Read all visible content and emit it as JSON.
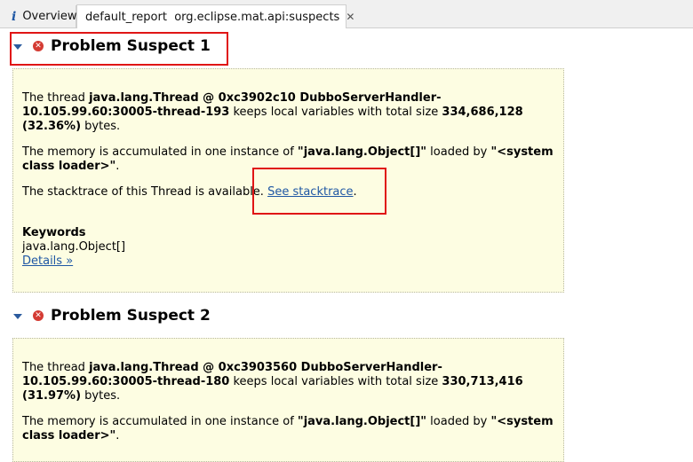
{
  "tabs": [
    {
      "label": "Overview",
      "icon": "info-icon"
    },
    {
      "label": "default_report  org.eclipse.mat.api:suspects",
      "icon": "gear-icon",
      "closable": true
    }
  ],
  "suspect1": {
    "title": "Problem Suspect 1",
    "p1": {
      "pre": "The thread ",
      "thread": "java.lang.Thread @ 0xc3902c10 DubboServerHandler-10.105.99.60:30005-thread-193",
      "mid": " keeps local variables with total size ",
      "size": "334,686,128",
      "sp": " ",
      "pct": "(32.36%)",
      "post": " bytes."
    },
    "p2": {
      "pre": "The memory is accumulated in one instance of ",
      "cls": "\"java.lang.Object[]\"",
      "mid": " loaded by ",
      "loader": "\"<system class loader>\"",
      "post": "."
    },
    "p3": {
      "pre": "The stacktrace of this Thread is available. ",
      "link": "See stacktrace",
      "post": "."
    },
    "keywords_title": "Keywords",
    "keywords_value": "java.lang.Object[]",
    "details_link": "Details »"
  },
  "suspect2": {
    "title": "Problem Suspect 2",
    "p1": {
      "pre": "The thread ",
      "thread": "java.lang.Thread @ 0xc3903560 DubboServerHandler-10.105.99.60:30005-thread-180",
      "mid": " keeps local variables with total size ",
      "size": "330,713,416",
      "sp": " ",
      "pct": "(31.97%)",
      "post": " bytes."
    },
    "p2": {
      "pre": "The memory is accumulated in one instance of ",
      "cls": "\"java.lang.Object[]\"",
      "mid": " loaded by ",
      "loader": "\"<system class loader>\"",
      "post": "."
    }
  },
  "colors": {
    "highlight": "#e01515",
    "panel_bg": "#fdfde2",
    "link": "#1f57a4",
    "error_icon": "#d43b33"
  }
}
